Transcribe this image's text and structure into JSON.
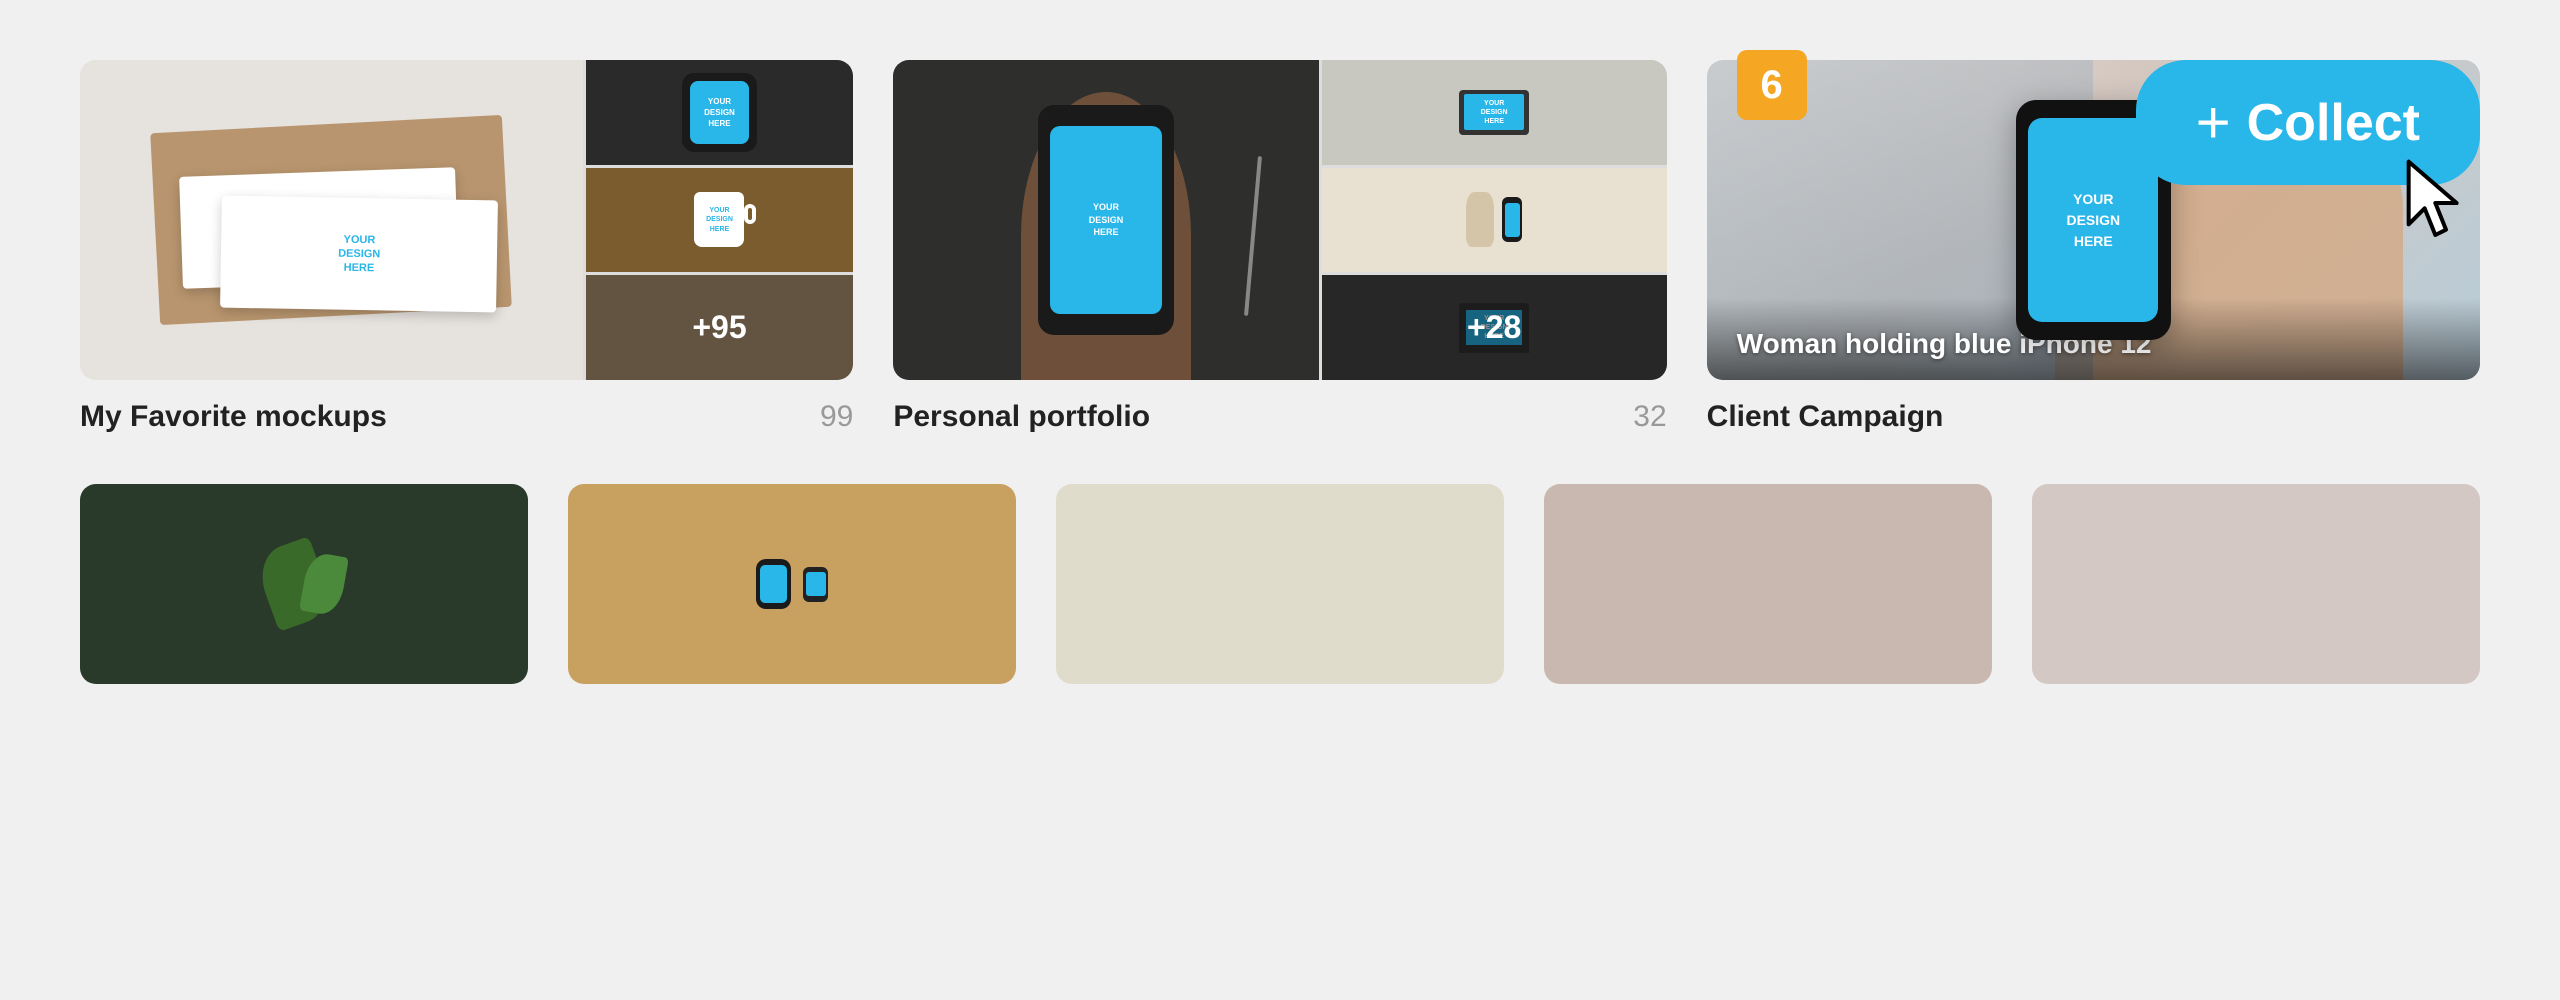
{
  "collect_button": {
    "label": "Collect",
    "plus": "+"
  },
  "collections": [
    {
      "id": "favorite",
      "title": "My Favorite mockups",
      "count": 99,
      "badge": null,
      "images": {
        "main": "business-cards-brown",
        "side": [
          "phone-hand-dark",
          "mug-wood",
          "person-room"
        ]
      },
      "side_overlay": "+95"
    },
    {
      "id": "portfolio",
      "title": "Personal portfolio",
      "count": 32,
      "badge": null,
      "images": {
        "main": "phone-hand-desk",
        "side": [
          "tv-room",
          "vase-phone",
          "laptop-dark"
        ]
      },
      "side_overlay": "+28"
    },
    {
      "id": "client",
      "title": "Client Campaign",
      "count": null,
      "badge": "6",
      "images": {
        "main": "woman-iphone-blue"
      },
      "caption": "Woman holding blue iPhone 12"
    }
  ],
  "bottom_row": [
    {
      "id": "plant",
      "bg": "dark-green"
    },
    {
      "id": "watch-phone",
      "bg": "wood-brown"
    },
    {
      "id": "office-desk",
      "bg": "light-gray"
    },
    {
      "id": "portrait-woman",
      "bg": "warm-gray"
    }
  ],
  "design_placeholder": "YOUR\nDESIGN\nHERE"
}
